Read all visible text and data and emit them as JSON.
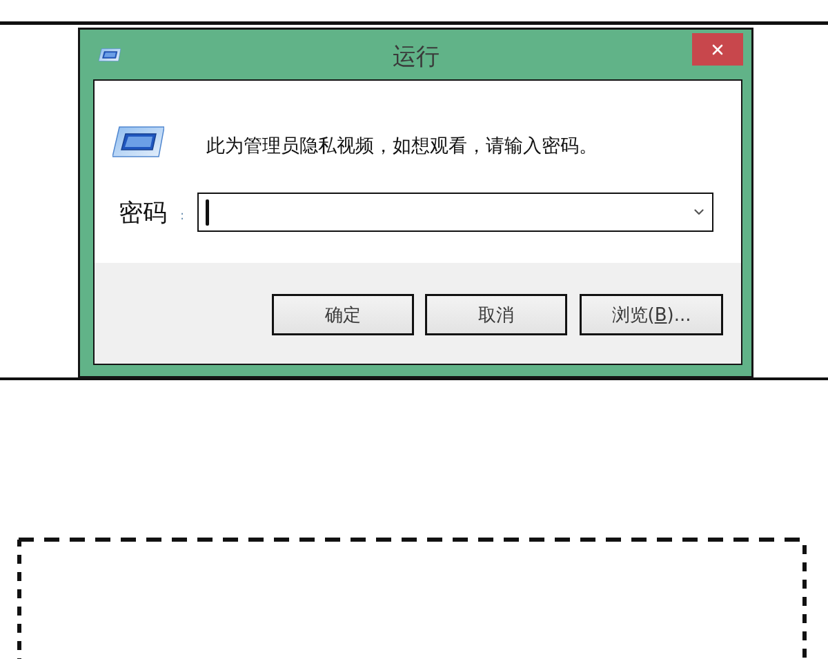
{
  "dialog": {
    "title": "运行",
    "message": "此为管理员隐私视频，如想观看，请输入密码。",
    "field": {
      "label": "密码",
      "separator": ":",
      "focused": true
    },
    "buttons": [
      {
        "label": "确定"
      },
      {
        "label": "取消"
      },
      {
        "label": "浏览(",
        "access_key": "B",
        "suffix": ")..."
      }
    ]
  }
}
